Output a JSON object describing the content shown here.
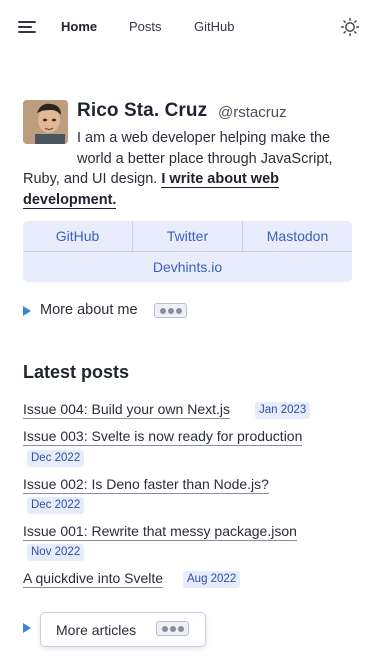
{
  "nav": {
    "home": "Home",
    "posts": "Posts",
    "github": "GitHub"
  },
  "profile": {
    "name": "Rico Sta. Cruz",
    "handle": "@rstacruz",
    "bio_line1": "I am a web developer helping make the",
    "bio_line2": "world a better place through JavaScript,",
    "bio_line3": "Ruby, and UI design.",
    "bio_link": "I write about web development."
  },
  "links": [
    "GitHub",
    "Twitter",
    "Mastodon",
    "Devhints.io"
  ],
  "more_about": "More about me",
  "latest": {
    "title": "Latest posts",
    "posts": [
      {
        "title": "Issue 004: Build your own Next.js",
        "date": "Jan 2023"
      },
      {
        "title": "Issue 003: Svelte is now ready for production",
        "date": "Dec 2022"
      },
      {
        "title": "Issue 002: Is Deno faster than Node.js?",
        "date": "Dec 2022"
      },
      {
        "title": "Issue 001: Rewrite that messy package.json",
        "date": "Nov 2022"
      },
      {
        "title": "A quickdive into Svelte",
        "date": "Aug 2022"
      }
    ]
  },
  "more_articles": "More articles",
  "colors": {
    "accent": "#3b5fc0",
    "link_bg": "#e8ecfb",
    "triangle": "#3b82d6"
  },
  "icons": [
    "menu-icon",
    "sun-icon",
    "avatar",
    "dots-icon",
    "triangle-icon"
  ]
}
